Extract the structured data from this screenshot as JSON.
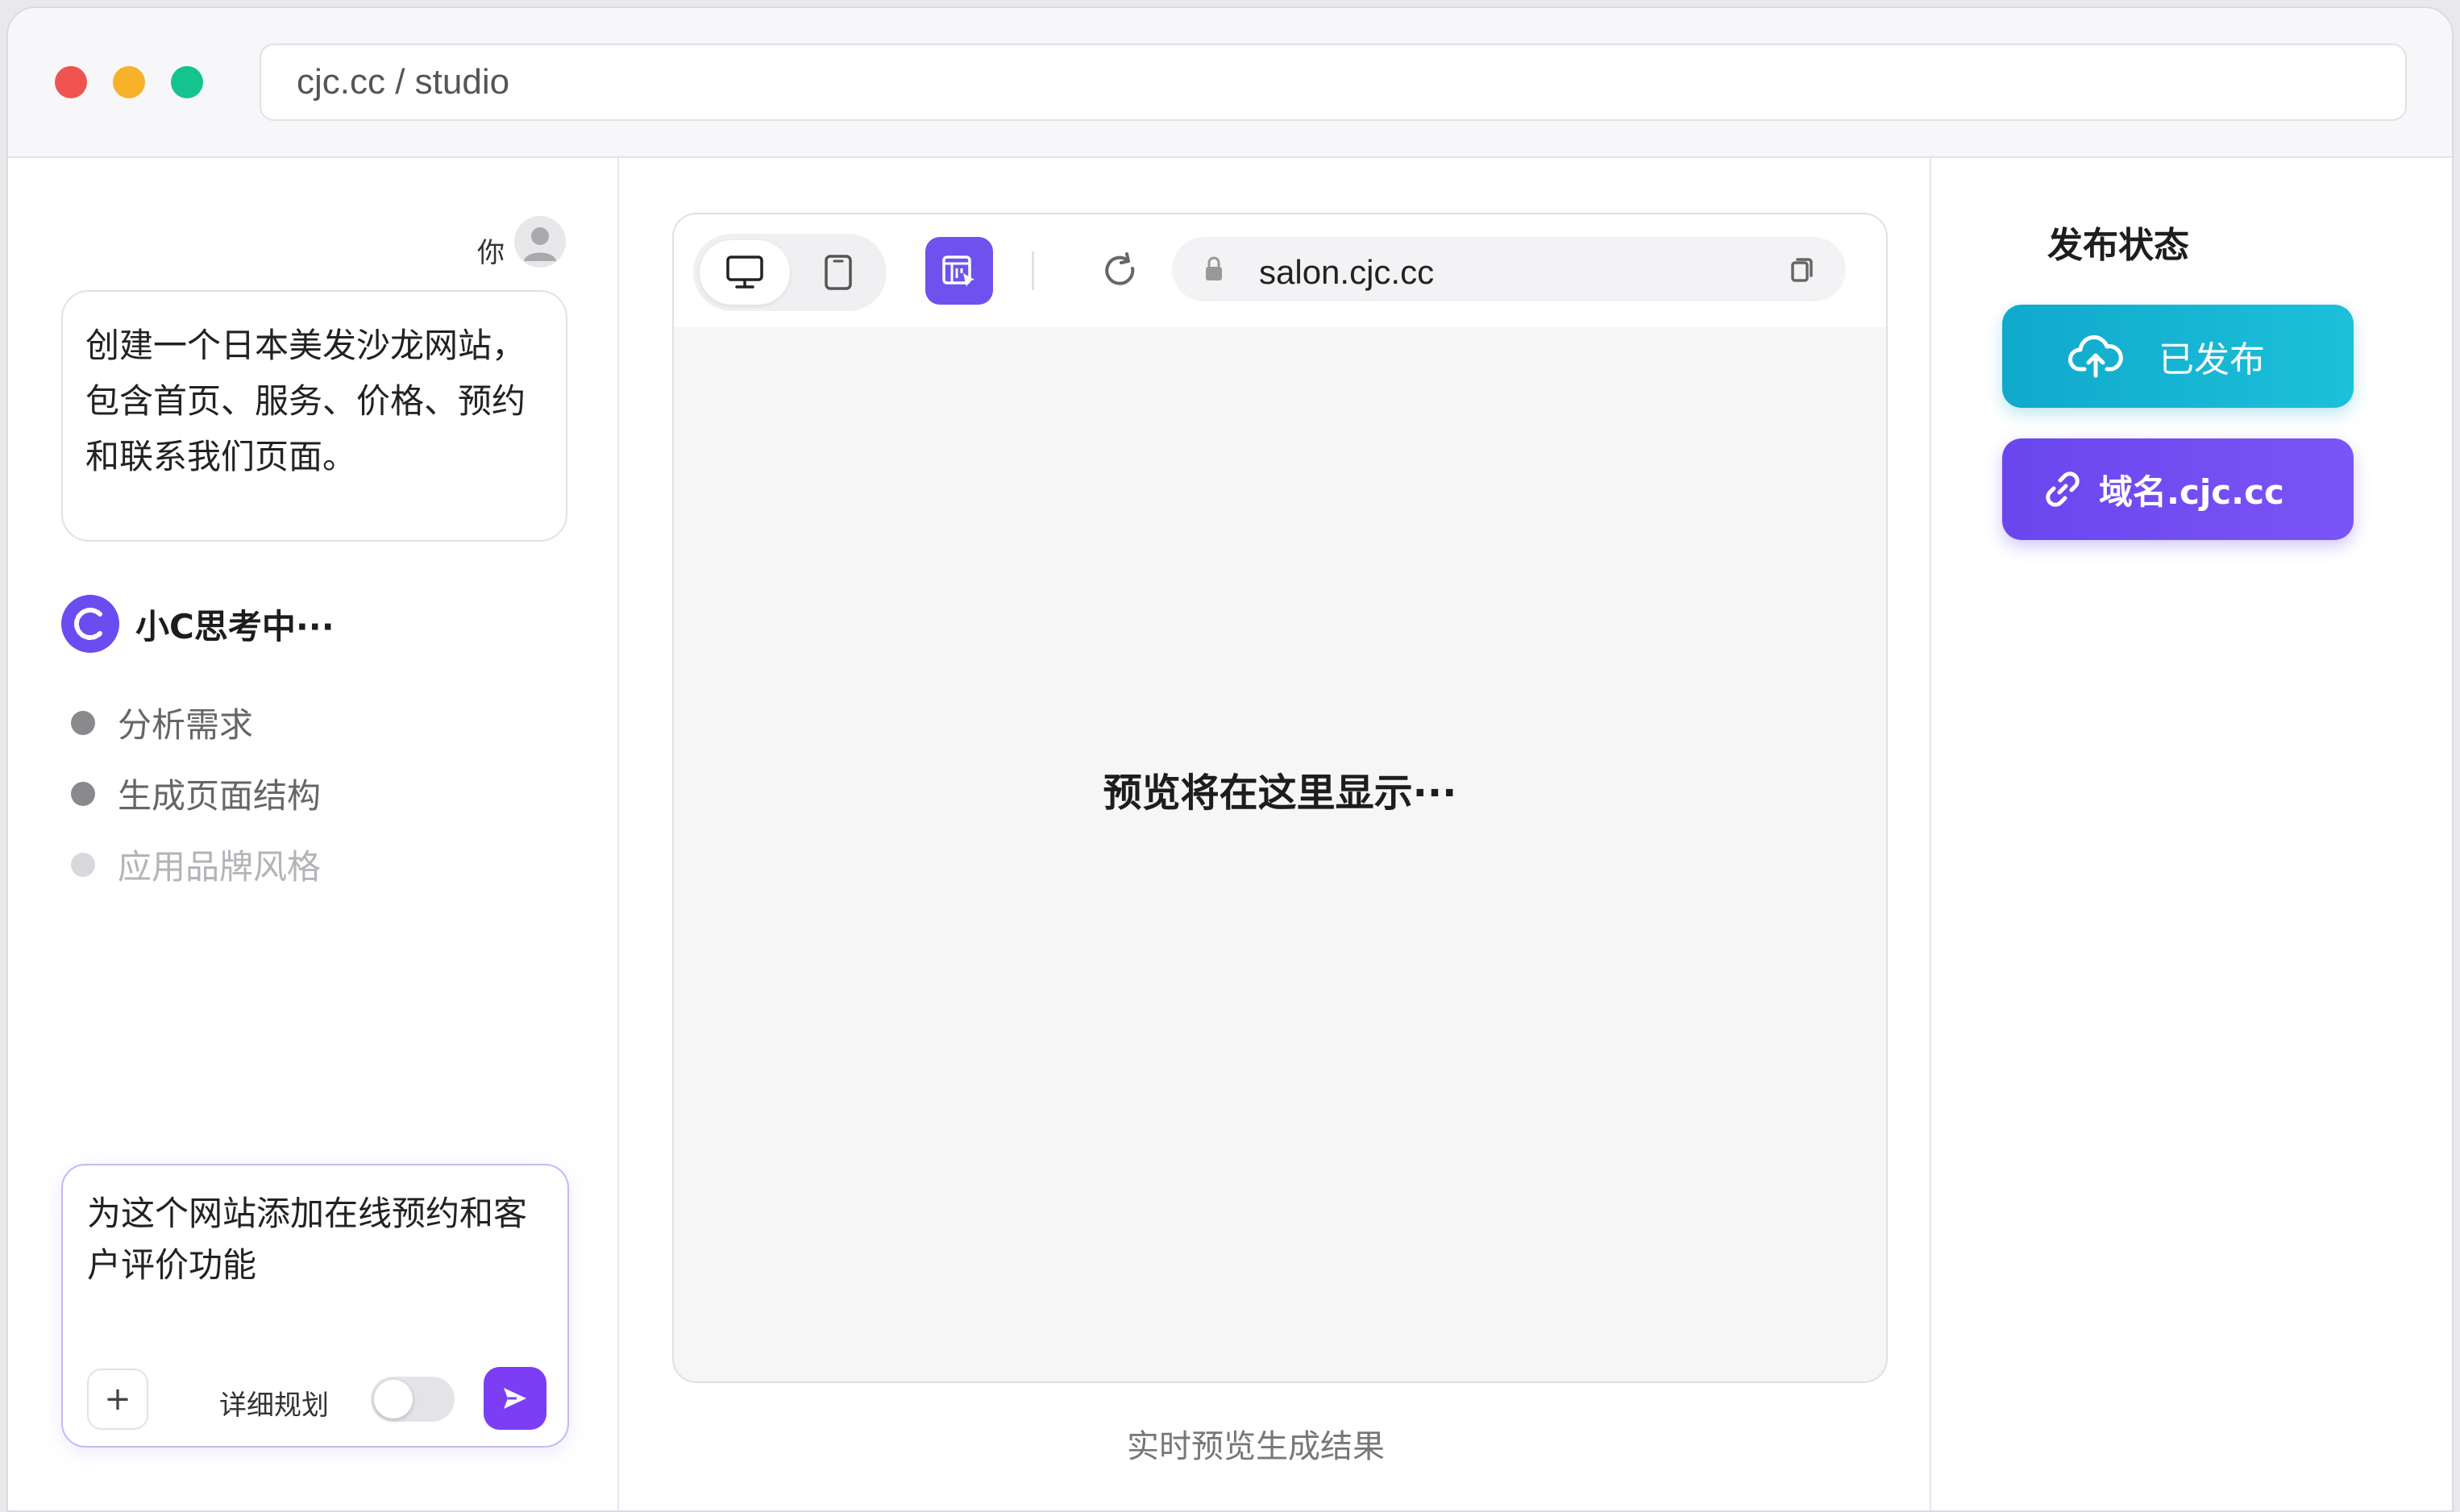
{
  "window": {
    "address": "cjc.cc / studio"
  },
  "chat": {
    "user_label": "你",
    "user_message": "创建一个日本美发沙龙网站，包含首页、服务、价格、预约和联系我们页面。",
    "assistant_name": "小C思考中···",
    "steps": [
      {
        "label": "分析需求",
        "status": "done"
      },
      {
        "label": "生成页面结构",
        "status": "done"
      },
      {
        "label": "应用品牌风格",
        "status": "pending"
      }
    ],
    "composer": {
      "text": "为这个网站添加在线预约和客户评价功能",
      "plan_toggle_label": "详细规划",
      "plan_toggle_on": false
    }
  },
  "preview": {
    "url": "salon.cjc.cc",
    "placeholder": "预览将在这里显示···",
    "caption": "实时预览生成结果",
    "active_device": "desktop"
  },
  "publish": {
    "title": "发布状态",
    "published_label": "已发布",
    "domain_label": "域名.cjc.cc",
    "colors": {
      "published": "#14b4d4",
      "domain": "#7050f2",
      "accent": "#7b3ef5"
    }
  },
  "icons": {
    "window_controls": [
      "close-dot",
      "minimize-dot",
      "maximize-dot"
    ],
    "toolbar": [
      "desktop-icon",
      "tablet-icon",
      "visual-edit-icon",
      "reload-icon",
      "lock-icon",
      "copy-icon"
    ],
    "publish": [
      "cloud-upload-icon",
      "link-icon"
    ],
    "composer": [
      "plus-icon",
      "send-icon"
    ]
  }
}
